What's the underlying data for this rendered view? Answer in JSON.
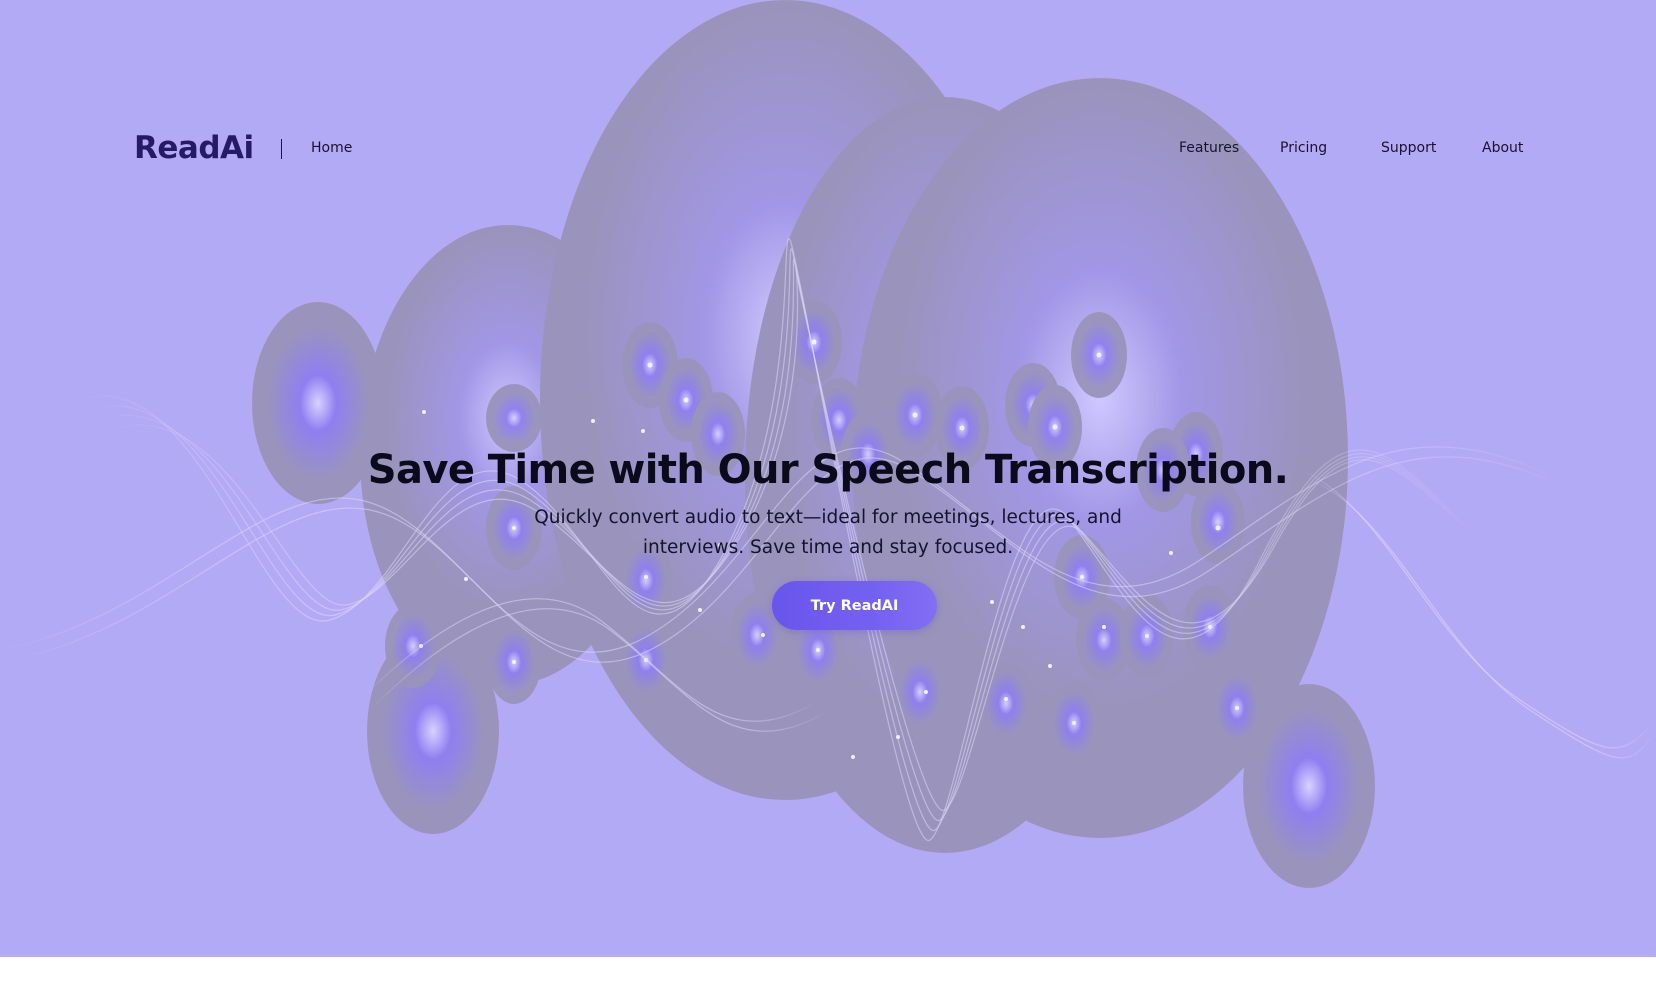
{
  "brand": {
    "logo_text": "ReadAi"
  },
  "nav": {
    "home": "Home",
    "features": "Features",
    "pricing": "Pricing",
    "support": "Support",
    "about": "About"
  },
  "hero": {
    "headline": "Save Time with Our Speech Transcription.",
    "subtitle": "Quickly convert audio to text—ideal for meetings, lectures, and interviews. Save time and stay focused.",
    "cta_label": "Try ReadAI"
  },
  "colors": {
    "hero_background": "#b3aaf5",
    "brand_text": "#241a66",
    "cta_background": "#6a55ec",
    "orb_fill": "#9a94bc"
  }
}
